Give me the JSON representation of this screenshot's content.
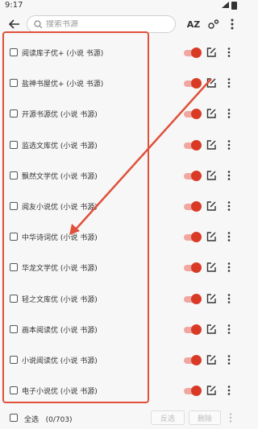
{
  "status_bar": {
    "time": "9:17"
  },
  "toolbar": {
    "search_placeholder": "搜索书源",
    "sort_label": "AZ",
    "group_label": "o°"
  },
  "sources": [
    {
      "name": "阅读库子优+ (小说 书源)",
      "enabled": true
    },
    {
      "name": "盐神书屋优+ (小说 书源)",
      "enabled": true
    },
    {
      "name": "开源书源优 (小说 书源)",
      "enabled": true
    },
    {
      "name": "监选文库优 (小说 书源)",
      "enabled": true
    },
    {
      "name": "飘然文学优 (小说 书源)",
      "enabled": true
    },
    {
      "name": "阅友小说优 (小说 书源)",
      "enabled": true
    },
    {
      "name": "中华诗词优 (小说 书源)",
      "enabled": true
    },
    {
      "name": "华龙文学优 (小说 书源)",
      "enabled": true
    },
    {
      "name": "轻之文库优 (小说 书源)",
      "enabled": true
    },
    {
      "name": "画本阅读优 (小说 书源)",
      "enabled": true
    },
    {
      "name": "小说阅读优 (小说 书源)",
      "enabled": true
    },
    {
      "name": "电子小说优 (小说 书源)",
      "enabled": true
    }
  ],
  "bottom_bar": {
    "select_all_label": "全选",
    "selection_count": "(0/703)",
    "invert_label": "反选",
    "delete_label": "删除"
  },
  "colors": {
    "accent": "#d93a26",
    "highlight": "#e0503a"
  }
}
